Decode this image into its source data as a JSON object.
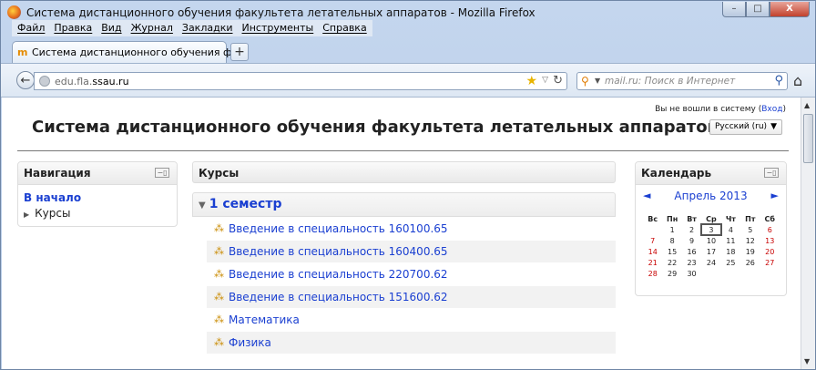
{
  "window": {
    "title": "Система дистанционного обучения факультета летательных аппаратов - Mozilla Firefox",
    "controls": {
      "minimize": "–",
      "maximize": "□",
      "close": "X"
    }
  },
  "menubar": [
    "Файл",
    "Правка",
    "Вид",
    "Журнал",
    "Закладки",
    "Инструменты",
    "Справка"
  ],
  "tab": {
    "label": "Система дистанционного обучения ф...",
    "icon": "moodle-icon",
    "new_tab": "+"
  },
  "navbar": {
    "back": "←",
    "url_host_prefix": "edu.fla.",
    "url_host_main": "ssau.ru",
    "search_placeholder": "mail.ru: Поиск в Интернет",
    "colors": {
      "accent": "#1a3fd1",
      "weekend": "#c80000"
    }
  },
  "page": {
    "site_title": "Система дистанционного обучения факультета летательных аппаратов",
    "login_text": "Вы не вошли в систему (",
    "login_link": "Вход",
    "login_close": ")",
    "language": "Русский (ru)"
  },
  "navigation": {
    "title": "Навигация",
    "home": "В начало",
    "courses": "Курсы"
  },
  "courses": {
    "title": "Курсы",
    "section": "1 семестр",
    "items": [
      "Введение в специальность 160100.65",
      "Введение в специальность 160400.65",
      "Введение в специальность 220700.62",
      "Введение в специальность 151600.62",
      "Математика",
      "Физика"
    ]
  },
  "calendar": {
    "title": "Календарь",
    "month": "Апрель 2013",
    "prev": "◄",
    "next": "►",
    "weekdays": [
      "Вс",
      "Пн",
      "Вт",
      "Ср",
      "Чт",
      "Пт",
      "Сб"
    ],
    "weeks": [
      [
        "",
        "1",
        "2",
        "3",
        "4",
        "5",
        "6"
      ],
      [
        "7",
        "8",
        "9",
        "10",
        "11",
        "12",
        "13"
      ],
      [
        "14",
        "15",
        "16",
        "17",
        "18",
        "19",
        "20"
      ],
      [
        "21",
        "22",
        "23",
        "24",
        "25",
        "26",
        "27"
      ],
      [
        "28",
        "29",
        "30",
        "",
        "",
        "",
        ""
      ]
    ],
    "today": "3"
  }
}
